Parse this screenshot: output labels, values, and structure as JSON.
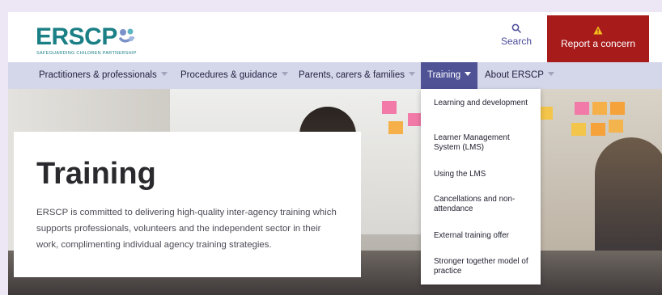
{
  "header": {
    "logo_text": "ERSCP",
    "logo_tagline": "SAFEGUARDING CHILDREN PARTNERSHIP",
    "search_label": "Search",
    "report_label": "Report a concern"
  },
  "nav": {
    "items": [
      {
        "label": "Practitioners & professionals"
      },
      {
        "label": "Procedures & guidance"
      },
      {
        "label": "Parents, carers & families"
      },
      {
        "label": "Training"
      },
      {
        "label": "About ERSCP"
      }
    ]
  },
  "dropdown": {
    "items": [
      {
        "label": "Learning and development"
      },
      {
        "label": "Learner Management System (LMS)"
      },
      {
        "label": "Using the LMS"
      },
      {
        "label": "Cancellations and non-attendance"
      },
      {
        "label": "External training offer"
      },
      {
        "label": "Stronger together model of practice"
      }
    ]
  },
  "hero": {
    "title": "Training",
    "text": "ERSCP is committed to delivering high-quality inter-agency training which supports professionals, volunteers and the independent sector in their work, complimenting individual agency training strategies."
  },
  "colors": {
    "brand_teal": "#1b7f86",
    "report_red": "#a81b1b",
    "nav_bg": "#d4d6ea",
    "nav_active": "#4f5396"
  },
  "icons": {
    "search": "search-icon",
    "warning": "warning-icon",
    "caret": "caret-down-icon"
  }
}
